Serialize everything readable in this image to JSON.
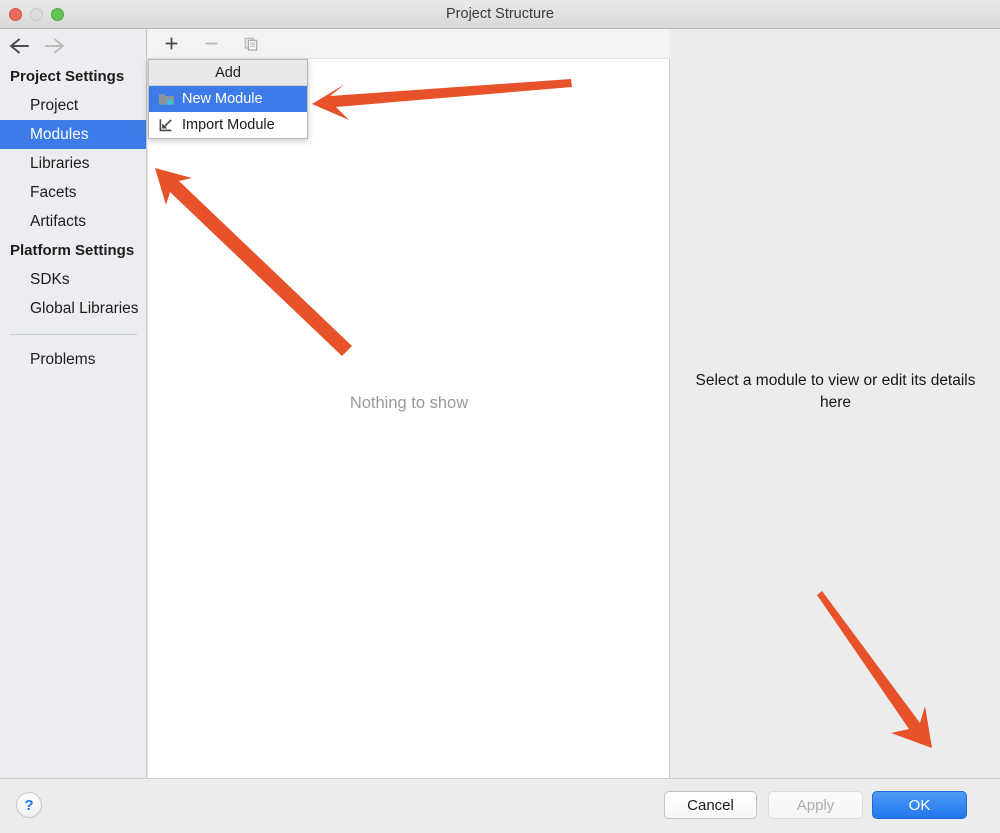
{
  "window": {
    "title": "Project Structure",
    "traffic_lights": [
      "close-button",
      "minimize-button",
      "zoom-button"
    ]
  },
  "navigation": {
    "back_icon": "arrow-left-icon",
    "forward_icon": "arrow-right-icon"
  },
  "sidebar": {
    "groups": [
      {
        "label": "Project Settings",
        "items": [
          {
            "label": "Project",
            "selected": false
          },
          {
            "label": "Modules",
            "selected": true
          },
          {
            "label": "Libraries",
            "selected": false
          },
          {
            "label": "Facets",
            "selected": false
          },
          {
            "label": "Artifacts",
            "selected": false
          }
        ]
      },
      {
        "label": "Platform Settings",
        "items": [
          {
            "label": "SDKs",
            "selected": false
          },
          {
            "label": "Global Libraries",
            "selected": false
          }
        ]
      }
    ],
    "footer_items": [
      {
        "label": "Problems",
        "selected": false
      }
    ]
  },
  "toolbar": {
    "buttons": [
      {
        "name": "add-button",
        "icon": "plus-icon",
        "enabled": true
      },
      {
        "name": "remove-button",
        "icon": "minus-icon",
        "enabled": false
      },
      {
        "name": "copy-button",
        "icon": "copy-icon",
        "enabled": false
      }
    ]
  },
  "add_menu": {
    "header": "Add",
    "items": [
      {
        "label": "New Module",
        "icon": "new-module-icon",
        "highlighted": true
      },
      {
        "label": "Import Module",
        "icon": "import-module-icon",
        "highlighted": false
      }
    ]
  },
  "modules_panel": {
    "empty_text": "Nothing to show"
  },
  "details_panel": {
    "message": "Select a module to view or edit its details here"
  },
  "footer": {
    "help_label": "?",
    "cancel_label": "Cancel",
    "apply_label": "Apply",
    "ok_label": "OK"
  },
  "annotations": {
    "arrow_color": "#E8522A",
    "arrows": [
      {
        "name": "arrow-to-new-module",
        "points_to": "New Module"
      },
      {
        "name": "arrow-to-sidebar",
        "points_to": "Libraries"
      },
      {
        "name": "arrow-to-ok-button",
        "points_to": "OK"
      }
    ]
  },
  "colors": {
    "selection_blue": "#3D7CE8",
    "accent_orange": "#E8522A",
    "panel_gray": "#ECECEC",
    "sidebar_gray": "#EBEDF0"
  }
}
